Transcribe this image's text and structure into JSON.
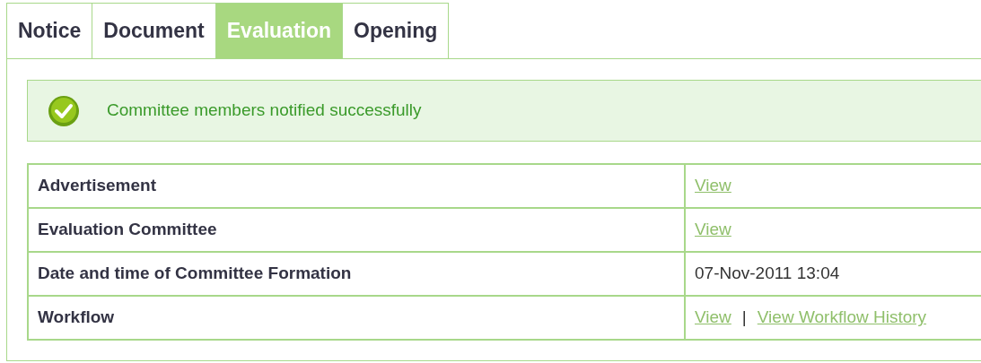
{
  "tabs": [
    {
      "label": "Notice",
      "selected": false
    },
    {
      "label": "Document",
      "selected": false
    },
    {
      "label": "Evaluation",
      "selected": true
    },
    {
      "label": "Opening",
      "selected": false
    }
  ],
  "message": {
    "kind": "success",
    "text": "Committee members notified successfully"
  },
  "table": {
    "rows": [
      {
        "label": "Advertisement",
        "value": [
          {
            "kind": "link",
            "text": "View"
          }
        ]
      },
      {
        "label": "Evaluation Committee",
        "value": [
          {
            "kind": "link",
            "text": "View"
          }
        ]
      },
      {
        "label": "Date and time of Committee Formation",
        "value": [
          {
            "kind": "text",
            "text": "07-Nov-2011 13:04"
          }
        ]
      },
      {
        "label": "Workflow",
        "value": [
          {
            "kind": "link",
            "text": "View"
          },
          {
            "kind": "separator",
            "text": "|"
          },
          {
            "kind": "link",
            "text": "View Workflow History"
          }
        ]
      }
    ]
  }
}
